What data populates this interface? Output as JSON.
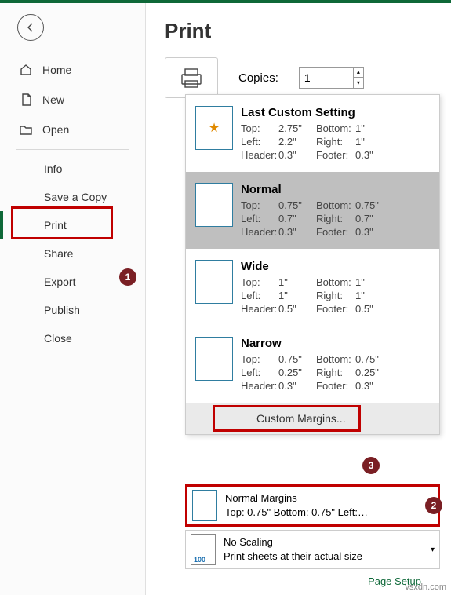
{
  "title": "Print",
  "sidebar": {
    "items": [
      {
        "label": "Home"
      },
      {
        "label": "New"
      },
      {
        "label": "Open"
      },
      {
        "label": "Info"
      },
      {
        "label": "Save a Copy"
      },
      {
        "label": "Print"
      },
      {
        "label": "Share"
      },
      {
        "label": "Export"
      },
      {
        "label": "Publish"
      },
      {
        "label": "Close"
      }
    ]
  },
  "copies": {
    "label": "Copies:",
    "value": "1"
  },
  "margins": {
    "options": [
      {
        "name": "Last Custom Setting",
        "top": "2.75\"",
        "left": "2.2\"",
        "header": "0.3\"",
        "bottom": "1\"",
        "right": "1\"",
        "footer": "0.3\""
      },
      {
        "name": "Normal",
        "top": "0.75\"",
        "left": "0.7\"",
        "header": "0.3\"",
        "bottom": "0.75\"",
        "right": "0.7\"",
        "footer": "0.3\""
      },
      {
        "name": "Wide",
        "top": "1\"",
        "left": "1\"",
        "header": "0.5\"",
        "bottom": "1\"",
        "right": "1\"",
        "footer": "0.5\""
      },
      {
        "name": "Narrow",
        "top": "0.75\"",
        "left": "0.25\"",
        "header": "0.3\"",
        "bottom": "0.75\"",
        "right": "0.25\"",
        "footer": "0.3\""
      }
    ],
    "labels": {
      "top": "Top:",
      "left": "Left:",
      "header": "Header:",
      "bottom": "Bottom:",
      "right": "Right:",
      "footer": "Footer:"
    },
    "custom": "Custom Margins..."
  },
  "selected": {
    "title": "Normal Margins",
    "detail": "Top: 0.75\" Bottom: 0.75\" Left:…"
  },
  "scaling": {
    "title": "No Scaling",
    "detail": "Print sheets at their actual size",
    "badge": "100"
  },
  "pageSetup": "Page Setup",
  "badges": {
    "b1": "1",
    "b2": "2",
    "b3": "3"
  },
  "watermark": "vsxdn.com"
}
